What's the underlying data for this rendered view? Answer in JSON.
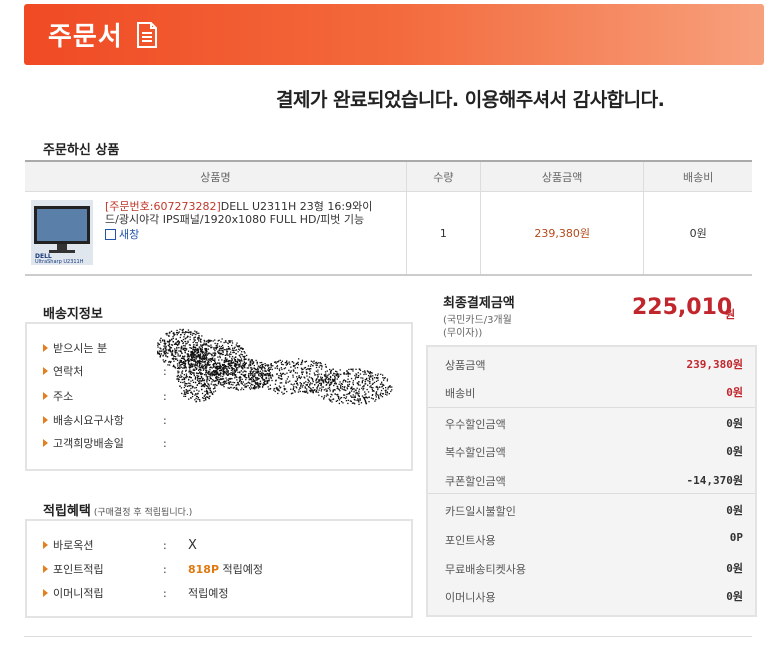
{
  "header": {
    "title": "주문서",
    "icon": "document-icon"
  },
  "complete_message": "결제가 완료되었습니다. 이용해주셔서 감사합니다.",
  "ordered_products": {
    "title": "주문하신 상품",
    "columns": [
      "상품명",
      "수량",
      "상품금액",
      "배송비"
    ],
    "items": [
      {
        "order_no": "[주문번호:607273282]",
        "name": "DELL U2311H 23형 16:9와이드/광시야각 IPS패널/1920x1080 FULL HD/피벗 기능",
        "thumb_brand": "DELL",
        "thumb_model": "UltraSharp U2311H",
        "review_label": "새창",
        "qty": "1",
        "price": "239,380원",
        "shipping": "0원"
      }
    ]
  },
  "shipping_info": {
    "title": "배송지정보",
    "rows": [
      {
        "label": "받으시는 분",
        "colon": ":",
        "value": ""
      },
      {
        "label": "연락처",
        "colon": ":",
        "value": ""
      },
      {
        "label": "주소",
        "colon": ":",
        "value": ""
      },
      {
        "label": "배송시요구사항",
        "colon": ":",
        "value": ""
      },
      {
        "label": "고객희망배송일",
        "colon": ":",
        "value": ""
      }
    ]
  },
  "points": {
    "title": "적립혜택",
    "subtitle": "(구매결정 후 적립됩니다.)",
    "rows": [
      {
        "label": "바로옥션",
        "colon": ":",
        "value": "X",
        "highlight": ""
      },
      {
        "label": "포인트적립",
        "colon": ":",
        "highlight": "818P",
        "value": "적립예정"
      },
      {
        "label": "이머니적립",
        "colon": ":",
        "highlight": "",
        "value": "적립예정"
      }
    ]
  },
  "payment": {
    "final_label": "최종결제금액",
    "final_sub1": "(국민카드/3개월",
    "final_sub2": "(무이자))",
    "final_amount": "225,010",
    "final_unit": "원",
    "rows": [
      {
        "label": "상품금액",
        "value": "239,380원"
      },
      {
        "label": "배송비",
        "value": "0원"
      },
      {
        "label": "우수할인금액",
        "value": "0원"
      },
      {
        "label": "복수할인금액",
        "value": "0원"
      },
      {
        "label": "쿠폰할인금액",
        "value": "-14,370원"
      },
      {
        "label": "카드일시불할인",
        "value": "0원"
      },
      {
        "label": "포인트사용",
        "value": "0P"
      },
      {
        "label": "무료배송티켓사용",
        "value": "0원"
      },
      {
        "label": "이머니사용",
        "value": "0원"
      }
    ]
  },
  "colors": {
    "header": "#f04a24",
    "accent_red": "#c0262c",
    "highlight_orange": "#e07a10"
  }
}
